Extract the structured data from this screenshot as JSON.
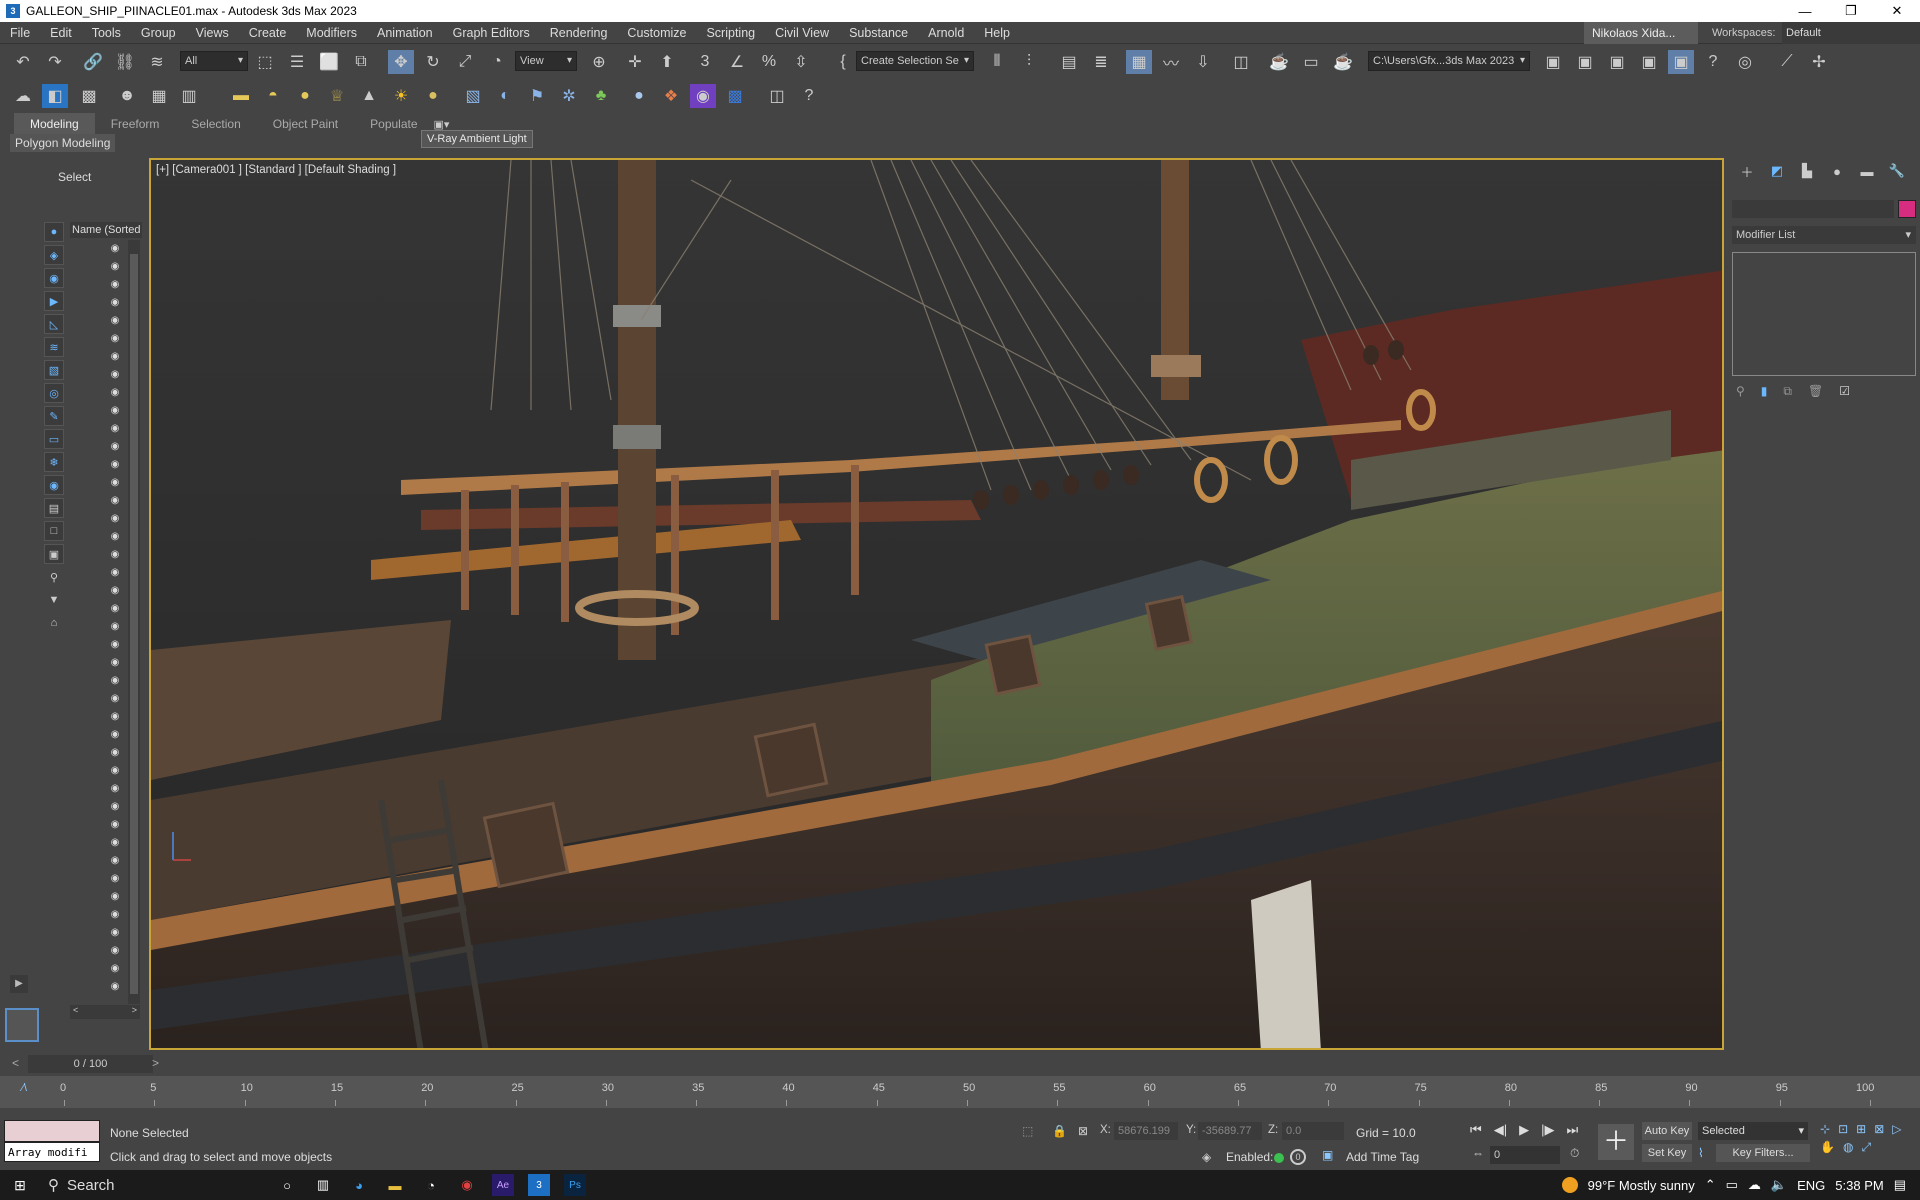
{
  "window": {
    "title": "GALLEON_SHIP_PIINACLE01.max - Autodesk 3ds Max 2023",
    "app_icon": "3"
  },
  "menu": {
    "items": [
      "File",
      "Edit",
      "Tools",
      "Group",
      "Views",
      "Create",
      "Modifiers",
      "Animation",
      "Graph Editors",
      "Rendering",
      "Customize",
      "Scripting",
      "Civil View",
      "Substance",
      "Arnold",
      "Help"
    ],
    "user": "Nikolaos Xida...",
    "workspaces_label": "Workspaces:",
    "workspaces_value": "Default"
  },
  "toolbar": {
    "filter_all": "All",
    "ref_coord": "View",
    "selection_set": "Create Selection Se",
    "project_path": "C:\\Users\\Gfx...3ds Max 2023"
  },
  "ribbon": {
    "tabs": [
      "Modeling",
      "Freeform",
      "Selection",
      "Object Paint",
      "Populate"
    ],
    "polygon_modeling": "Polygon Modeling",
    "tooltip": "V-Ray Ambient Light"
  },
  "scene_explorer": {
    "select_label": "Select",
    "name_header": "Name (Sorted A"
  },
  "viewport": {
    "label": "[+] [Camera001 ] [Standard ] [Default Shading ]"
  },
  "command_panel": {
    "modifier_list": "Modifier List",
    "object_color": "#d62d80"
  },
  "timeline": {
    "frame_display": "0 / 100",
    "ticks": [
      "0",
      "5",
      "10",
      "15",
      "20",
      "25",
      "30",
      "35",
      "40",
      "45",
      "50",
      "55",
      "60",
      "65",
      "70",
      "75",
      "80",
      "85",
      "90",
      "95",
      "100"
    ]
  },
  "status": {
    "maxscript_text": "Array modifi",
    "selection": "None Selected",
    "prompt": "Click and drag to select and move objects",
    "x_label": "X:",
    "x_value": "58676.199",
    "y_label": "Y:",
    "y_value": "-35689.77",
    "z_label": "Z:",
    "z_value": "0.0",
    "grid": "Grid = 10.0",
    "enabled": "Enabled:",
    "add_time_tag": "Add Time Tag",
    "auto_key": "Auto Key",
    "set_key": "Set Key",
    "key_mode": "Selected",
    "key_filters": "Key Filters...",
    "current_frame": "0"
  },
  "taskbar": {
    "search": "Search",
    "weather": "99°F  Mostly sunny",
    "language": "ENG",
    "time": "5:38 PM"
  }
}
